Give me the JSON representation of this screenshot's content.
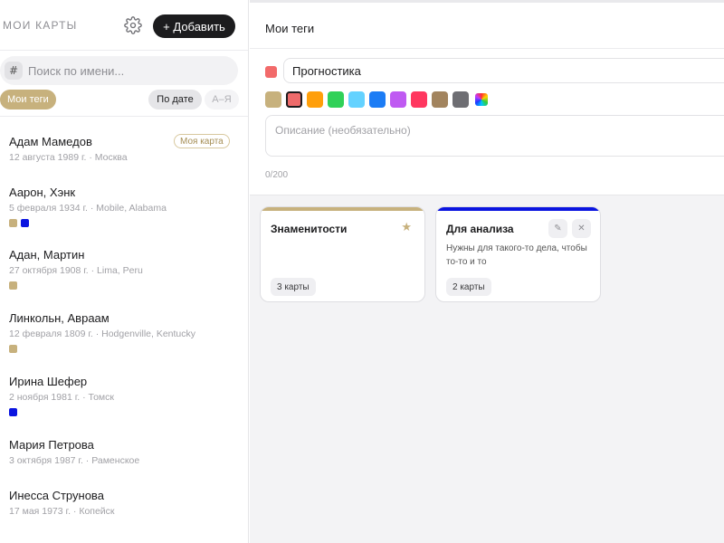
{
  "sidebar": {
    "title": "МОИ КАРТЫ",
    "add_label": "+ Добавить",
    "search": {
      "hash": "#",
      "placeholder": "Поиск по имени..."
    },
    "filters": {
      "tags_label": "Мои теги",
      "date_label": "По дате",
      "az_label": "А–Я"
    },
    "people": [
      {
        "name": "Адам Мамедов",
        "meta": "12 августа 1989 г. · Москва",
        "badge": "Моя карта",
        "tag_colors": []
      },
      {
        "name": "Аарон, Хэнк",
        "meta": "5 февраля 1934 г. · Mobile, Alabama",
        "badge": "",
        "tag_colors": [
          "#c7b17d",
          "#0a14e0"
        ]
      },
      {
        "name": "Адан, Мартин",
        "meta": "27 октября 1908 г. · Lima, Peru",
        "badge": "",
        "tag_colors": [
          "#c7b17d"
        ]
      },
      {
        "name": "Линкольн, Авраам",
        "meta": "12 февраля 1809 г. · Hodgenville, Kentucky",
        "badge": "",
        "tag_colors": [
          "#c7b17d"
        ]
      },
      {
        "name": "Ирина Шефер",
        "meta": "2 ноября 1981 г. · Томск",
        "badge": "",
        "tag_colors": [
          "#0a14e0"
        ]
      },
      {
        "name": "Мария Петрова",
        "meta": "3 октября 1987 г. · Раменское",
        "badge": "",
        "tag_colors": []
      },
      {
        "name": "Инесса Струнова",
        "meta": "17 мая 1973 г. · Копейск",
        "badge": "",
        "tag_colors": []
      }
    ]
  },
  "main": {
    "title": "Мои теги",
    "editor": {
      "current_color": "#f26a6a",
      "name_value": "Прогностика",
      "swatches": [
        {
          "color": "#c7b17d",
          "selected": false
        },
        {
          "color": "#ee6b6b",
          "selected": true
        },
        {
          "color": "#ff9f0a",
          "selected": false
        },
        {
          "color": "#30d158",
          "selected": false
        },
        {
          "color": "#64d2ff",
          "selected": false
        },
        {
          "color": "#1c7cf5",
          "selected": false
        },
        {
          "color": "#bf5af2",
          "selected": false
        },
        {
          "color": "#ff375f",
          "selected": false
        },
        {
          "color": "#a2845e",
          "selected": false
        },
        {
          "color": "#6e6e73",
          "selected": false
        },
        {
          "color": "rainbow",
          "selected": false
        }
      ],
      "desc_placeholder": "Описание (необязательно)",
      "counter": "0/200"
    },
    "cards": [
      {
        "title": "Знаменитости",
        "desc": "",
        "count": "3 карты",
        "bar_color": "#c7b17d",
        "starred": true,
        "star": "★"
      },
      {
        "title": "Для анализа",
        "desc": "Нужны для такого-то дела, чтобы то-то и то",
        "count": "2 карты",
        "bar_color": "#0a14e0",
        "starred": false,
        "edit": "✎",
        "close": "✕"
      }
    ]
  }
}
